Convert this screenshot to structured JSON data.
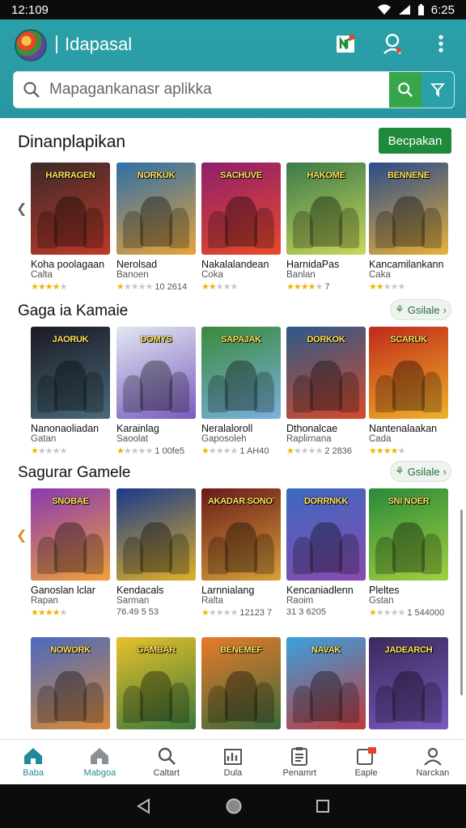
{
  "status": {
    "time": "12:109",
    "clock": "6:25"
  },
  "header": {
    "app_title": "Idapasal",
    "search_placeholder": "Mapagankanasr aplikka"
  },
  "colors": {
    "accent": "#2aa0a8",
    "primary": "#1f8a3a",
    "star": "#f2b400"
  },
  "sections": [
    {
      "title": "Dinanplapikan",
      "action": "Becpakan",
      "cards": [
        {
          "name": "Koha poolagaan",
          "sub": "Calta",
          "rating": "",
          "stars": 4,
          "colors": [
            "#3a2a28",
            "#c0392b"
          ],
          "banner": "HARRAGEN"
        },
        {
          "name": "Nerolsad",
          "sub": "Banoen",
          "rating": "10 2614",
          "stars": 1,
          "colors": [
            "#2e6fa8",
            "#e8a33a"
          ],
          "banner": "NORKUK"
        },
        {
          "name": "Nakalalandean",
          "sub": "Coka",
          "rating": "",
          "stars": 2,
          "colors": [
            "#8e1f6b",
            "#e84a2a"
          ],
          "banner": "SACHUVE"
        },
        {
          "name": "HarnidaPas",
          "sub": "Banlan",
          "rating": "7",
          "stars": 4,
          "colors": [
            "#3a7a4a",
            "#c9d85a"
          ],
          "banner": "HAKOME"
        },
        {
          "name": "Kancamilankann",
          "sub": "Caka",
          "rating": "",
          "stars": 2,
          "colors": [
            "#2a4a8a",
            "#e8b23a"
          ],
          "banner": "BENNENE"
        }
      ]
    },
    {
      "title": "Gaga ia Kamaie",
      "action": "Gsilale",
      "cards": [
        {
          "name": "Nanonaoliadan",
          "sub": "Gatan",
          "rating": "",
          "stars": 1,
          "colors": [
            "#1a1a24",
            "#4a6a7a"
          ],
          "banner": "JAORUK"
        },
        {
          "name": "Karainlag",
          "sub": "Saoolat",
          "rating": "1 00fe5",
          "stars": 1,
          "colors": [
            "#e0e8f0",
            "#7a5ac0"
          ],
          "banner": "DOMYS"
        },
        {
          "name": "Neralaloroll",
          "sub": "Gaposoleh",
          "rating": "1 AH40",
          "stars": 1,
          "colors": [
            "#3a8a3a",
            "#7ab0e0"
          ],
          "banner": "SAPAJAK"
        },
        {
          "name": "Dthonalcae",
          "sub": "Raplirnana",
          "rating": "2 2836",
          "stars": 1,
          "colors": [
            "#2a5a8a",
            "#d84a2a"
          ],
          "banner": "DORKOK"
        },
        {
          "name": "Nantenalaakan",
          "sub": "Cada",
          "rating": "",
          "stars": 4,
          "colors": [
            "#c02a1a",
            "#f0b02a"
          ],
          "banner": "SCARUK"
        }
      ]
    },
    {
      "title": "Sagurar Gamele",
      "action": "Gsilale",
      "cards": [
        {
          "name": "Ganoslan lclar",
          "sub": "Rapan",
          "rating": "",
          "stars": 4,
          "colors": [
            "#8a3ab0",
            "#f0a03a"
          ],
          "banner": "SNOBAE"
        },
        {
          "name": "Kendacals",
          "sub": "Sarman",
          "rating": "76.49 5 53",
          "stars": 0,
          "colors": [
            "#1a3a8a",
            "#e0b02a"
          ],
          "banner": ""
        },
        {
          "name": "Larnnialang",
          "sub": "Ralta",
          "rating": "12123 7",
          "stars": 1,
          "colors": [
            "#6a1a1a",
            "#d8a03a"
          ],
          "banner": "AKADAR SONOT"
        },
        {
          "name": "Kencaniadlenn",
          "sub": "Raoim",
          "rating": "31 3 6205",
          "stars": 0,
          "colors": [
            "#3a6ac0",
            "#8a4ab0"
          ],
          "banner": "DORRNKK"
        },
        {
          "name": "Pleltes",
          "sub": "Gstan",
          "rating": "1 544000",
          "stars": 1,
          "colors": [
            "#2a8a3a",
            "#a0d040"
          ],
          "banner": "SNI NOER"
        }
      ]
    },
    {
      "title": "",
      "action": "",
      "cards": [
        {
          "name": "",
          "sub": "",
          "rating": "",
          "stars": 0,
          "colors": [
            "#4a6ac0",
            "#d88a3a"
          ],
          "banner": "NOWORK"
        },
        {
          "name": "",
          "sub": "",
          "rating": "",
          "stars": 0,
          "colors": [
            "#e8c02a",
            "#3a7a3a"
          ],
          "banner": "GAMBAR"
        },
        {
          "name": "",
          "sub": "",
          "rating": "",
          "stars": 0,
          "colors": [
            "#e87a2a",
            "#3a6a3a"
          ],
          "banner": "BENEMEF"
        },
        {
          "name": "",
          "sub": "",
          "rating": "",
          "stars": 0,
          "colors": [
            "#3aa0e0",
            "#c03a3a"
          ],
          "banner": "NAVAK"
        },
        {
          "name": "",
          "sub": "",
          "rating": "",
          "stars": 0,
          "colors": [
            "#3a2a5a",
            "#7a5ac0"
          ],
          "banner": "JADEARCH"
        }
      ]
    }
  ],
  "nav": [
    {
      "label": "Baba",
      "icon": "home-icon"
    },
    {
      "label": "Mabgoa",
      "icon": "home-outline-icon"
    },
    {
      "label": "Caltart",
      "icon": "search-icon"
    },
    {
      "label": "Dula",
      "icon": "chart-icon"
    },
    {
      "label": "Penamrt",
      "icon": "clipboard-icon"
    },
    {
      "label": "Eaple",
      "icon": "notification-icon"
    },
    {
      "label": "Narckan",
      "icon": "profile-icon"
    }
  ]
}
